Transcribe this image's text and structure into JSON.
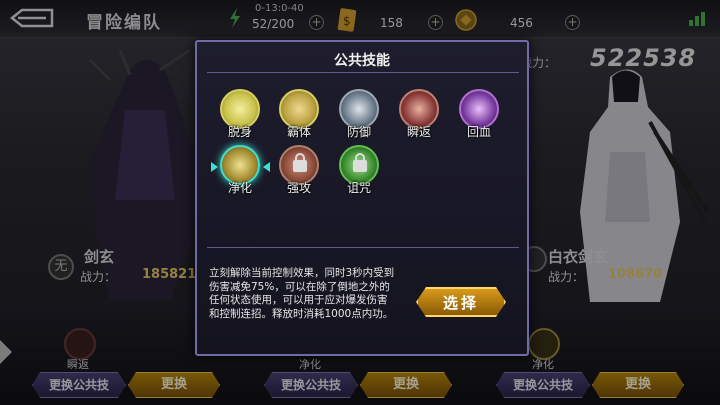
{
  "topbar": {
    "title": "冒险编队",
    "stamina_timer": "0-13:0-40",
    "stamina": "52/200",
    "coins": "158",
    "gems": "456"
  },
  "team": {
    "total_power_label": "战力：",
    "total_power": "522538",
    "characters": [
      {
        "name": "剑玄",
        "power_label": "战力：",
        "power": "185821",
        "sect": "无",
        "skill": "瞬返"
      },
      {
        "name": "",
        "power_label": "",
        "power": "",
        "sect": "",
        "skill": "净化"
      },
      {
        "name": "白衣剑玄",
        "power_label": "战力：",
        "power": "108670",
        "sect": "",
        "skill": "净化"
      }
    ],
    "change_skill_label": "更换公共技",
    "change_label": "更换"
  },
  "modal": {
    "title": "公共技能",
    "skills": [
      {
        "label": "脱身",
        "icon": "escape-icon",
        "color": "#c8c24a",
        "locked": false
      },
      {
        "label": "霸体",
        "icon": "armor-body-icon",
        "color": "#b8a040",
        "locked": false
      },
      {
        "label": "防御",
        "icon": "shield-icon",
        "color": "#6a7a8a",
        "locked": false
      },
      {
        "label": "瞬返",
        "icon": "slash-icon",
        "color": "#8a3a3a",
        "locked": false
      },
      {
        "label": "回血",
        "icon": "heal-icon",
        "color": "#7a3aa0",
        "locked": false
      },
      {
        "label": "净化",
        "icon": "purify-icon",
        "color": "#a08a30",
        "locked": false,
        "selected": true
      },
      {
        "label": "强攻",
        "icon": "lock-icon",
        "color": "#8a4a3a",
        "locked": true
      },
      {
        "label": "诅咒",
        "icon": "lock-icon",
        "color": "#3a8a30",
        "locked": true
      }
    ],
    "description": "立刻解除当前控制效果，同时3秒内受到伤害减免75%，可以在除了倒地之外的任何状态使用，可以用于应对爆发伤害和控制连招。释放时消耗1000点内功。",
    "select_label": "选择"
  },
  "colors": {
    "accent_border": "#6f6aa8",
    "gold": "#e9c766",
    "selected_ring": "#3fe0d0"
  }
}
